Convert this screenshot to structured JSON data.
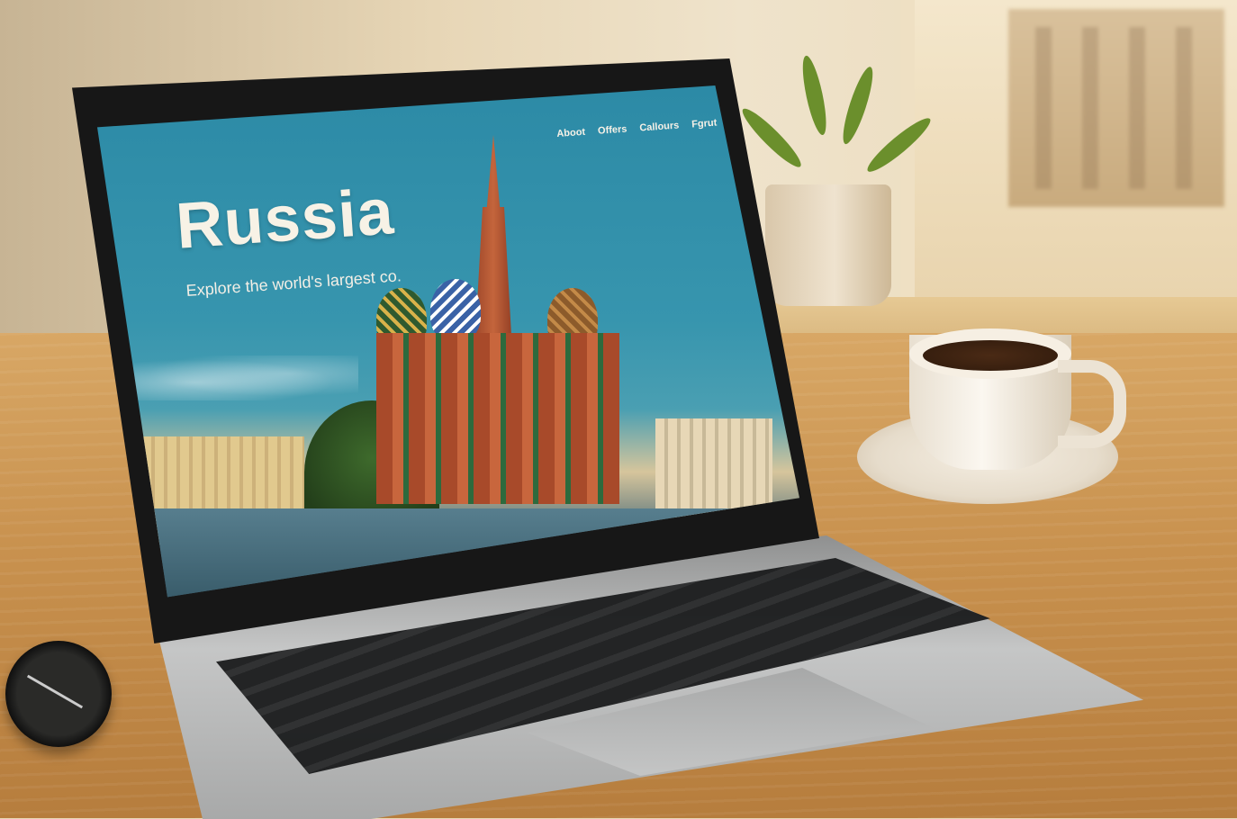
{
  "website": {
    "title": "Russia",
    "tagline": "Explore the world's largest co.",
    "nav": [
      {
        "label": "Aboot"
      },
      {
        "label": "Offers"
      },
      {
        "label": "Callours"
      },
      {
        "label": "Fgrut"
      }
    ]
  }
}
